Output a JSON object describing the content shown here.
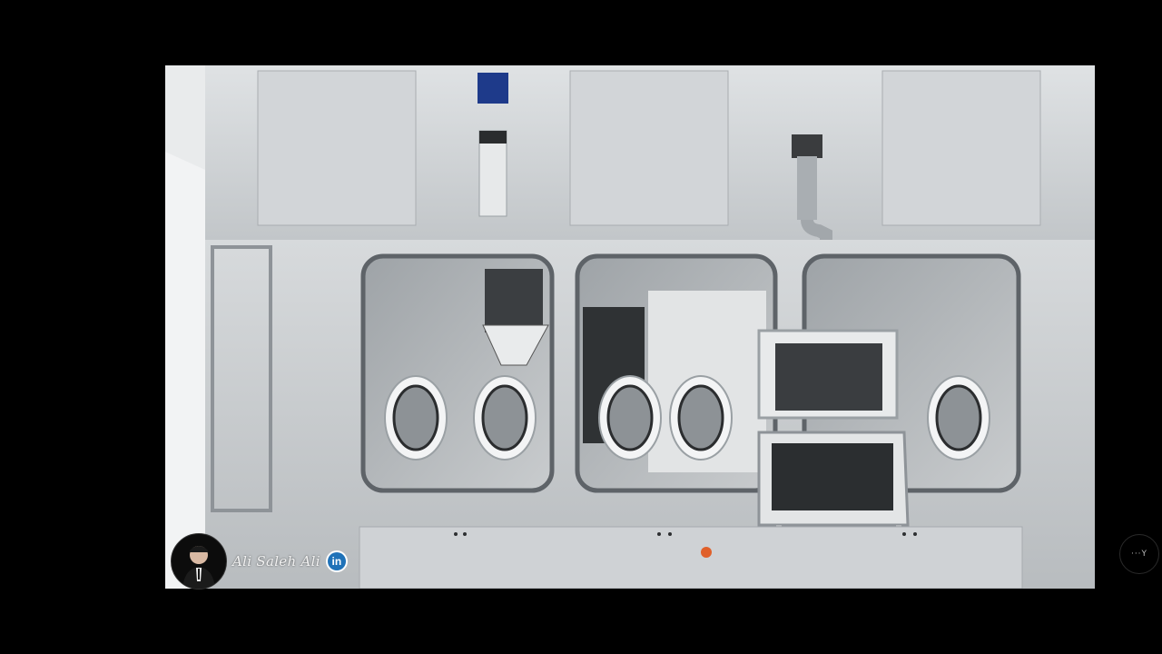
{
  "video": {
    "scene_icon": "isolator-machine-illustration"
  },
  "watermark": {
    "name": "Ali Saleh Ali",
    "linkedin_label": "in",
    "linkedin_color": "#1f72b8",
    "avatar_icon": "profile-photo-icon"
  },
  "overlay": {
    "corner_icon": "settings-dots-icon",
    "corner_label": "···Y"
  },
  "colors": {
    "background": "#000000",
    "steel": "#c4c8cb",
    "steel_dark": "#8e9398",
    "screen": "#3a3d40"
  }
}
